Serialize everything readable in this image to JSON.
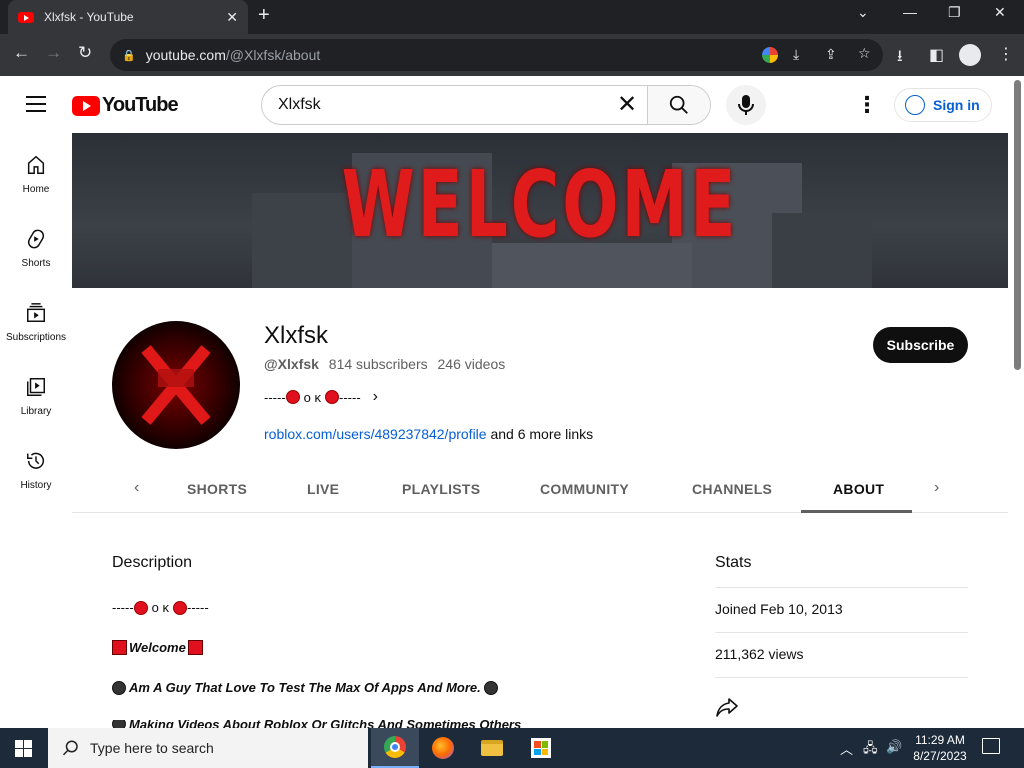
{
  "browser": {
    "tab_title": "Xlxfsk - YouTube",
    "tab_close": "✕",
    "new_tab": "+",
    "url_host": "youtube.com",
    "url_path": "/@Xlxfsk/about"
  },
  "yt": {
    "logo_text": "YouTube",
    "search_value": "Xlxfsk",
    "signin_label": "Sign in"
  },
  "leftnav": [
    {
      "label": "Home",
      "icon": "home-icon"
    },
    {
      "label": "Shorts",
      "icon": "shorts-icon"
    },
    {
      "label": "Subscriptions",
      "icon": "subscriptions-icon"
    },
    {
      "label": "Library",
      "icon": "library-icon"
    },
    {
      "label": "History",
      "icon": "history-icon"
    }
  ],
  "banner": {
    "text": "WELCOME"
  },
  "channel": {
    "name": "Xlxfsk",
    "handle": "@Xlxfsk",
    "subscribers": "814 subscribers",
    "videos": "246 videos",
    "tagline_left": "-----",
    "tagline_mid": "ᴏ ᴋ",
    "tagline_right": "-----",
    "link": "roblox.com/users/489237842/profile",
    "more_links": "and 6 more links",
    "subscribe_label": "Subscribe"
  },
  "tabs": [
    "SHORTS",
    "LIVE",
    "PLAYLISTS",
    "COMMUNITY",
    "CHANNELS",
    "ABOUT"
  ],
  "about": {
    "description_title": "Description",
    "lines": [
      "-----",
      "ᴏ ᴋ",
      "-----",
      "Welcome",
      "Am A Guy That Love To Test The Max Of Apps And More.",
      "Making Videos About Roblox Or Glitchs And Sometimes Others"
    ],
    "stats_title": "Stats",
    "joined": "Joined Feb 10, 2013",
    "views": "211,362 views"
  },
  "taskbar": {
    "search_placeholder": "Type here to search",
    "time": "11:29 AM",
    "date": "8/27/2023"
  }
}
